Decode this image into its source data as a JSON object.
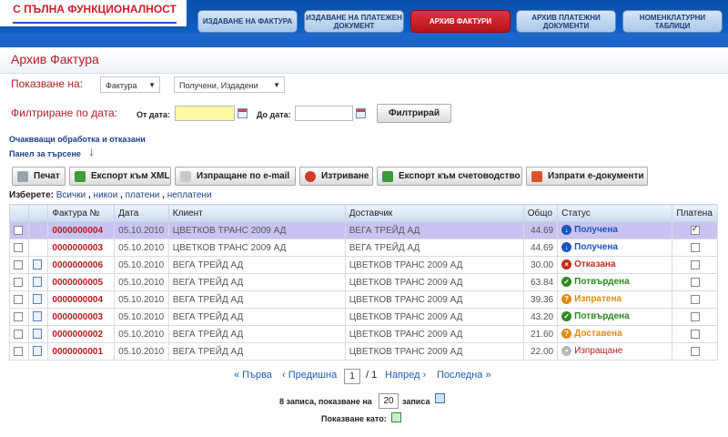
{
  "header": {
    "logo_text": "С ПЪЛНА ФУНКЦИОНАЛНОСТ",
    "nav_tabs": [
      {
        "label": "ИЗДАВАНЕ НА ФАКТУРА",
        "active": false
      },
      {
        "label": "ИЗДАВАНЕ НА ПЛАТЕЖЕН ДОКУМЕНТ",
        "active": false
      },
      {
        "label": "АРХИВ ФАКТУРИ",
        "active": true
      },
      {
        "label": "АРХИВ ПЛАТЕЖНИ ДОКУМЕНТИ",
        "active": false
      },
      {
        "label": "НОМЕНКЛАТУРНИ ТАБЛИЦИ",
        "active": false
      }
    ]
  },
  "page": {
    "title": "Архив Фактура",
    "show_label": "Показване на:",
    "doc_type_select": "Фактура",
    "direction_select": "Получени, Издадени",
    "filter_label": "Филтриране по дата:",
    "from_label": "От дата:",
    "from_value": "",
    "to_label": "До дата:",
    "to_value": "",
    "filter_button": "Филтрирай",
    "pending_link": "Очаквващи обработка и отказани",
    "search_panel_link": "Панел за търсене",
    "red_arrow": "↓"
  },
  "toolbar": {
    "print": "Печат",
    "export_xml": "Експорт към XML",
    "send_email": "Изпращане по e-mail",
    "delete": "Изтриване",
    "export_accounting": "Експорт към счетоводство",
    "send_edocs": "Изпрати е-документи"
  },
  "select_links": {
    "label": "Изберете:",
    "all": "Всички",
    "none": "никои",
    "paid": "платени",
    "unpaid": "неплатени"
  },
  "table": {
    "headers": [
      "Фактура №",
      "Дата",
      "Клиент",
      "Доставчик",
      "Общо",
      "Статус",
      "Платена"
    ],
    "rows": [
      {
        "number": "0000000004",
        "date": "05.10.2010",
        "client": "ЦВЕТКОВ ТРАНС 2009 АД",
        "supplier": "ВЕГА ТРЕЙД АД",
        "total": "44.69",
        "status": "Получена",
        "status_icon": "arrow-down-circle-icon",
        "status_color": "#1a56b8",
        "paid": true,
        "doc_icon": false,
        "highlight": true
      },
      {
        "number": "0000000003",
        "date": "05.10.2010",
        "client": "ЦВЕТКОВ ТРАНС 2009 АД",
        "supplier": "ВЕГА ТРЕЙД АД",
        "total": "44.69",
        "status": "Получена",
        "status_icon": "arrow-down-circle-icon",
        "status_color": "#1a56b8",
        "paid": false,
        "doc_icon": false,
        "highlight": false
      },
      {
        "number": "0000000006",
        "date": "05.10.2010",
        "client": "ВЕГА ТРЕЙД АД",
        "supplier": "ЦВЕТКОВ ТРАНС 2009 АД",
        "total": "30.00",
        "status": "Отказана",
        "status_icon": "x-circle-icon",
        "status_color": "#c8281e",
        "paid": false,
        "doc_icon": true,
        "highlight": false
      },
      {
        "number": "0000000005",
        "date": "05.10.2010",
        "client": "ВЕГА ТРЕЙД АД",
        "supplier": "ЦВЕТКОВ ТРАНС 2009 АД",
        "total": "63.84",
        "status": "Потвърдена",
        "status_icon": "check-circle-icon",
        "status_color": "#2a8a1e",
        "paid": false,
        "doc_icon": true,
        "highlight": false
      },
      {
        "number": "0000000004",
        "date": "05.10.2010",
        "client": "ВЕГА ТРЕЙД АД",
        "supplier": "ЦВЕТКОВ ТРАНС 2009 АД",
        "total": "39.36",
        "status": "Изпратена",
        "status_icon": "question-circle-icon",
        "status_color": "#e08a12",
        "paid": false,
        "doc_icon": true,
        "highlight": false
      },
      {
        "number": "0000000003",
        "date": "05.10.2010",
        "client": "ВЕГА ТРЕЙД АД",
        "supplier": "ЦВЕТКОВ ТРАНС 2009 АД",
        "total": "43.20",
        "status": "Потвърдена",
        "status_icon": "check-circle-icon",
        "status_color": "#2a8a1e",
        "paid": false,
        "doc_icon": true,
        "highlight": false
      },
      {
        "number": "0000000002",
        "date": "05.10.2010",
        "client": "ВЕГА ТРЕЙД АД",
        "supplier": "ЦВЕТКОВ ТРАНС 2009 АД",
        "total": "21.60",
        "status": "Доставена",
        "status_icon": "question-circle-icon",
        "status_color": "#e08a12",
        "paid": false,
        "doc_icon": true,
        "highlight": false
      },
      {
        "number": "0000000001",
        "date": "05.10.2010",
        "client": "ВЕГА ТРЕЙД АД",
        "supplier": "ЦВЕТКОВ ТРАНС 2009 АД",
        "total": "22.00",
        "status": "Изпращане",
        "status_icon": "sending-icon",
        "status_color": "#b02025",
        "paid": false,
        "doc_icon": true,
        "highlight": false
      }
    ]
  },
  "pager": {
    "first": "« Първа",
    "prev": "‹ Предишна",
    "current_page": "1",
    "of_pages": "/ 1",
    "next": "Напред ›",
    "last": "Последна »",
    "records_info": "8 записа, показване на",
    "rows_per_page": "20",
    "records_suffix": "записа",
    "show_as": "Показване като:"
  }
}
